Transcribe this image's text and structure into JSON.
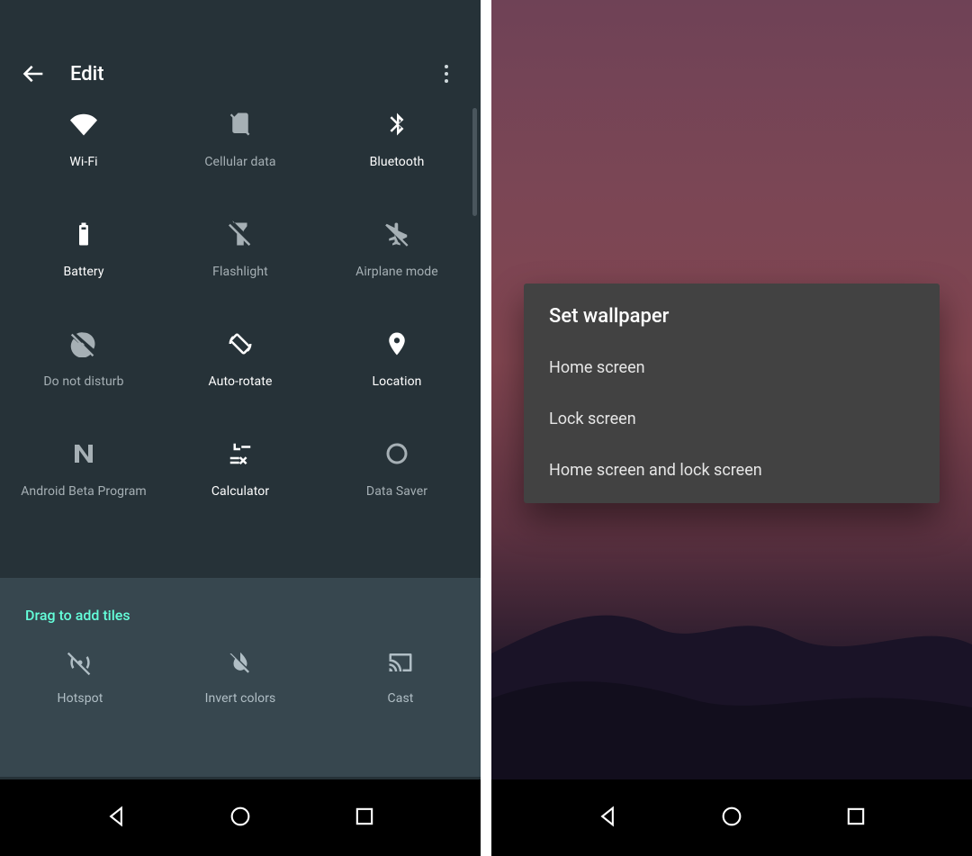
{
  "left": {
    "header": {
      "title": "Edit"
    },
    "tiles": [
      {
        "key": "wifi",
        "label": "Wi-Fi",
        "active": true
      },
      {
        "key": "cellular",
        "label": "Cellular data",
        "active": false
      },
      {
        "key": "bluetooth",
        "label": "Bluetooth",
        "active": true
      },
      {
        "key": "battery",
        "label": "Battery",
        "active": true
      },
      {
        "key": "flashlight",
        "label": "Flashlight",
        "active": false
      },
      {
        "key": "airplane",
        "label": "Airplane mode",
        "active": false
      },
      {
        "key": "dnd",
        "label": "Do not disturb",
        "active": false
      },
      {
        "key": "autorotate",
        "label": "Auto-rotate",
        "active": true
      },
      {
        "key": "location",
        "label": "Location",
        "active": true
      },
      {
        "key": "beta",
        "label": "Android Beta Program",
        "active": false
      },
      {
        "key": "calculator",
        "label": "Calculator",
        "active": true
      },
      {
        "key": "datasaver",
        "label": "Data Saver",
        "active": false
      }
    ],
    "drag_label": "Drag to add tiles",
    "extra_tiles": [
      {
        "key": "hotspot",
        "label": "Hotspot"
      },
      {
        "key": "invertcolors",
        "label": "Invert colors"
      },
      {
        "key": "cast",
        "label": "Cast"
      }
    ]
  },
  "right": {
    "dialog": {
      "title": "Set wallpaper",
      "options": [
        "Home screen",
        "Lock screen",
        "Home screen and lock screen"
      ]
    }
  }
}
